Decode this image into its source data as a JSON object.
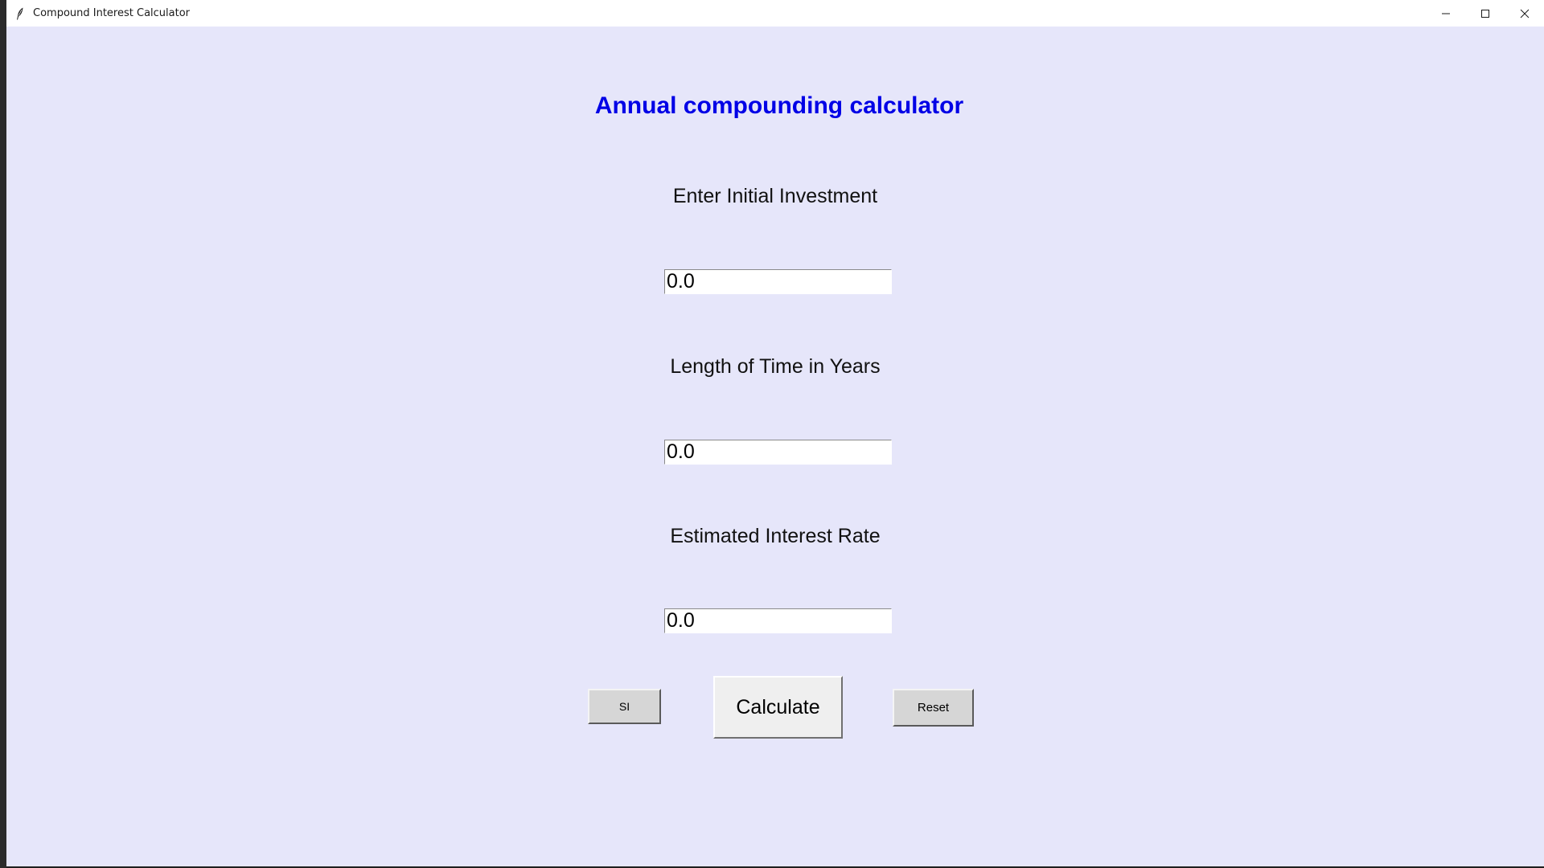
{
  "window": {
    "title": "Compound Interest Calculator",
    "icon": "feather-icon",
    "controls": [
      "minimize-icon",
      "maximize-icon",
      "close-icon"
    ]
  },
  "app": {
    "heading": "Annual compounding calculator",
    "heading_color": "#0000e6",
    "background_color": "#e6e6fa",
    "fields": [
      {
        "label": "Enter Initial Investment",
        "value": "0.0"
      },
      {
        "label": "Length of Time in Years",
        "value": "0.0"
      },
      {
        "label": "Estimated Interest Rate",
        "value": "0.0"
      }
    ],
    "buttons": {
      "si": "SI",
      "calculate": "Calculate",
      "reset": "Reset"
    }
  }
}
